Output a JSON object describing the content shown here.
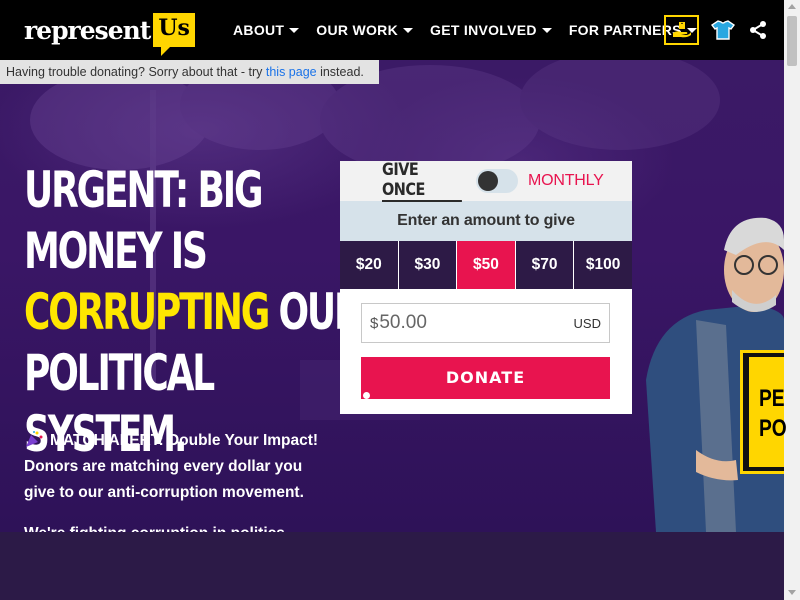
{
  "header": {
    "logo_word": "represent",
    "logo_us": "Us",
    "nav": [
      {
        "label": "ABOUT"
      },
      {
        "label": "OUR WORK"
      },
      {
        "label": "GET INVOLVED"
      },
      {
        "label": "FOR PARTNERS"
      }
    ],
    "icons": [
      "donate-hand-icon",
      "shirt-icon",
      "share-icon"
    ]
  },
  "notice": {
    "before": "Having trouble donating? Sorry about that - try ",
    "link": "this page",
    "after": " instead."
  },
  "hero": {
    "headline_line1": "URGENT: BIG",
    "headline_line2": "MONEY IS",
    "headline_highlight": "CORRUPTING",
    "headline_line3_rest": " OUR",
    "headline_line4": "POLITICAL SYSTEM.",
    "match_line1": "MATCH ALERT: Double Your Impact!",
    "match_line2": "Donors are matching every dollar you",
    "match_line3": "give to our anti-corruption movement.",
    "cut_line": "We're fighting corruption in politics"
  },
  "widget": {
    "give_once": "GIVE ONCE",
    "monthly": "MONTHLY",
    "amount_label": "Enter an amount to give",
    "amounts": [
      "$20",
      "$30",
      "$50",
      "$70",
      "$100"
    ],
    "selected_amount": "$50",
    "currency_symbol": "$",
    "amount_value": "50.00",
    "currency_code": "USD",
    "donate_label": "DONATE"
  },
  "sign": {
    "line1": "PE",
    "line2": "PO"
  },
  "colors": {
    "accent_pink": "#e8144f",
    "accent_yellow": "#ffe600",
    "dark_purple": "#2d1a46"
  }
}
